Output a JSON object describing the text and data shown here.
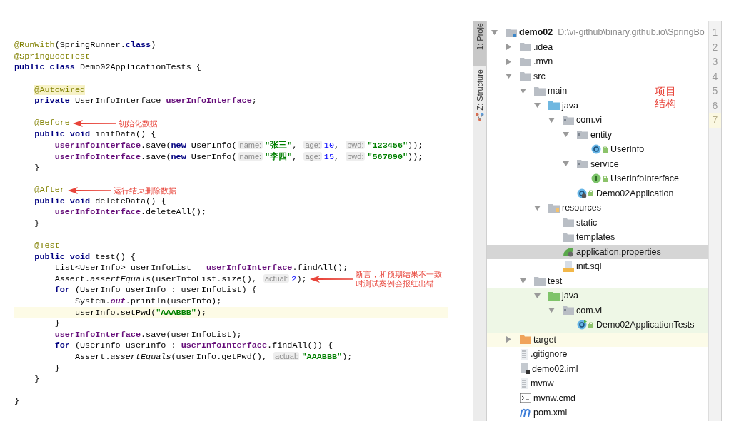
{
  "code": {
    "lines": [
      {
        "tokens": [
          {
            "kind": "ann",
            "t": "@RunWith"
          },
          {
            "kind": "plain",
            "t": "(SpringRunner."
          },
          {
            "kind": "kw",
            "t": "class"
          },
          {
            "kind": "plain",
            "t": ")"
          }
        ]
      },
      {
        "tokens": [
          {
            "kind": "ann",
            "t": "@SpringBootTest"
          }
        ]
      },
      {
        "tokens": [
          {
            "kind": "kw",
            "t": "public class "
          },
          {
            "kind": "plain",
            "t": "Demo02ApplicationTests {"
          }
        ]
      },
      {
        "kind": "blank"
      },
      {
        "tokens": [
          {
            "kind": "annhl",
            "t": "    @Autowired"
          }
        ]
      },
      {
        "tokens": [
          {
            "kind": "kw",
            "t": "    private "
          },
          {
            "kind": "plain",
            "t": "UserInfoInterface "
          },
          {
            "kind": "field",
            "t": "userInfoInterface"
          },
          {
            "kind": "plain",
            "t": ";"
          }
        ]
      },
      {
        "kind": "blank"
      },
      {
        "tokens": [
          {
            "kind": "ann",
            "t": "    @Before"
          }
        ],
        "note": {
          "text": "初始化数据"
        }
      },
      {
        "tokens": [
          {
            "kind": "kw",
            "t": "    public void "
          },
          {
            "kind": "plain",
            "t": "initData() {"
          }
        ]
      },
      {
        "tokens": [
          {
            "kind": "field",
            "t": "        userInfoInterface"
          },
          {
            "kind": "plain",
            "t": ".save("
          },
          {
            "kind": "kw",
            "t": "new "
          },
          {
            "kind": "plain",
            "t": "UserInfo("
          },
          {
            "kind": "hint",
            "t": "name:"
          },
          {
            "kind": "str",
            "t": "\"张三\""
          },
          {
            "kind": "plain",
            "t": ", "
          },
          {
            "kind": "hint",
            "t": "age:"
          },
          {
            "kind": "num",
            "t": "10"
          },
          {
            "kind": "plain",
            "t": ", "
          },
          {
            "kind": "hint",
            "t": "pwd:"
          },
          {
            "kind": "str",
            "t": "\"123456\""
          },
          {
            "kind": "plain",
            "t": "));"
          }
        ]
      },
      {
        "tokens": [
          {
            "kind": "field",
            "t": "        userInfoInterface"
          },
          {
            "kind": "plain",
            "t": ".save("
          },
          {
            "kind": "kw",
            "t": "new "
          },
          {
            "kind": "plain",
            "t": "UserInfo("
          },
          {
            "kind": "hint",
            "t": "name:"
          },
          {
            "kind": "str",
            "t": "\"李四\""
          },
          {
            "kind": "plain",
            "t": ", "
          },
          {
            "kind": "hint",
            "t": "age:"
          },
          {
            "kind": "num",
            "t": "15"
          },
          {
            "kind": "plain",
            "t": ", "
          },
          {
            "kind": "hint",
            "t": "pwd:"
          },
          {
            "kind": "str",
            "t": "\"567890\""
          },
          {
            "kind": "plain",
            "t": "));"
          }
        ]
      },
      {
        "tokens": [
          {
            "kind": "plain",
            "t": "    }"
          }
        ]
      },
      {
        "kind": "blank"
      },
      {
        "tokens": [
          {
            "kind": "ann",
            "t": "    @After"
          }
        ],
        "note": {
          "text": "运行结束删除数据"
        }
      },
      {
        "tokens": [
          {
            "kind": "kw",
            "t": "    public void "
          },
          {
            "kind": "plain",
            "t": "deleteData() {"
          }
        ]
      },
      {
        "tokens": [
          {
            "kind": "field",
            "t": "        userInfoInterface"
          },
          {
            "kind": "plain",
            "t": ".deleteAll();"
          }
        ]
      },
      {
        "tokens": [
          {
            "kind": "plain",
            "t": "    }"
          }
        ]
      },
      {
        "kind": "blank"
      },
      {
        "tokens": [
          {
            "kind": "ann",
            "t": "    @Test"
          }
        ]
      },
      {
        "tokens": [
          {
            "kind": "kw",
            "t": "    public void "
          },
          {
            "kind": "plain",
            "t": "test() {"
          }
        ]
      },
      {
        "tokens": [
          {
            "kind": "plain",
            "t": "        List<UserInfo> userInfoList = "
          },
          {
            "kind": "field",
            "t": "userInfoInterface"
          },
          {
            "kind": "plain",
            "t": ".findAll();"
          }
        ]
      },
      {
        "tokens": [
          {
            "kind": "plain",
            "t": "        Assert."
          },
          {
            "kind": "ital",
            "t": "assertEquals"
          },
          {
            "kind": "plain",
            "t": "(userInfoList.size(), "
          },
          {
            "kind": "hint",
            "t": "actual:"
          },
          {
            "kind": "num",
            "t": "2"
          },
          {
            "kind": "plain",
            "t": ");"
          }
        ],
        "note": {
          "text": "断言，和预期结果不一致时测试案例会报红出错"
        }
      },
      {
        "tokens": [
          {
            "kind": "kw",
            "t": "        for "
          },
          {
            "kind": "plain",
            "t": "(UserInfo userInfo : userInfoList) {"
          }
        ]
      },
      {
        "tokens": [
          {
            "kind": "plain",
            "t": "            System."
          },
          {
            "kind": "static",
            "t": "out"
          },
          {
            "kind": "plain",
            "t": ".println(userInfo);"
          }
        ]
      },
      {
        "tokens": [
          {
            "kind": "plain",
            "t": "            userInfo.setPwd("
          },
          {
            "kind": "str",
            "t": "\"AAABBB\""
          },
          {
            "kind": "plain",
            "t": ");"
          }
        ],
        "current": true
      },
      {
        "tokens": [
          {
            "kind": "plain",
            "t": "        }"
          }
        ]
      },
      {
        "tokens": [
          {
            "kind": "field",
            "t": "        userInfoInterface"
          },
          {
            "kind": "plain",
            "t": ".save(userInfoList);"
          }
        ]
      },
      {
        "tokens": [
          {
            "kind": "kw",
            "t": "        for "
          },
          {
            "kind": "plain",
            "t": "(UserInfo userInfo : "
          },
          {
            "kind": "field",
            "t": "userInfoInterface"
          },
          {
            "kind": "plain",
            "t": ".findAll()) {"
          }
        ]
      },
      {
        "tokens": [
          {
            "kind": "plain",
            "t": "            Assert."
          },
          {
            "kind": "ital",
            "t": "assertEquals"
          },
          {
            "kind": "plain",
            "t": "(userInfo.getPwd(), "
          },
          {
            "kind": "hint",
            "t": "actual:"
          },
          {
            "kind": "str",
            "t": "\"AAABBB\""
          },
          {
            "kind": "plain",
            "t": ");"
          }
        ]
      },
      {
        "tokens": [
          {
            "kind": "plain",
            "t": "        }"
          }
        ]
      },
      {
        "tokens": [
          {
            "kind": "plain",
            "t": "    }"
          }
        ]
      },
      {
        "kind": "blank"
      },
      {
        "tokens": [
          {
            "kind": "plain",
            "t": "}"
          }
        ]
      }
    ]
  },
  "side_tabs": [
    {
      "label": "1: Proje",
      "selected": true
    },
    {
      "label": "Z: Structure",
      "selected": false
    }
  ],
  "project_tree": {
    "note": "项目结构",
    "items": [
      {
        "label": "demo02",
        "path": "D:\\vi-github\\binary.github.io\\SpringBo",
        "kind": "module",
        "expanded": true,
        "selected": false,
        "children": [
          {
            "label": ".idea",
            "kind": "folder",
            "expanded": false,
            "selected": false
          },
          {
            "label": ".mvn",
            "kind": "folder",
            "expanded": false,
            "selected": false
          },
          {
            "label": "src",
            "kind": "folder",
            "expanded": true,
            "selected": false,
            "children": [
              {
                "label": "main",
                "kind": "folder",
                "expanded": true,
                "selected": false,
                "children": [
                  {
                    "label": "java",
                    "kind": "source-folder",
                    "expanded": true,
                    "selected": false,
                    "children": [
                      {
                        "label": "com.vi",
                        "kind": "package",
                        "expanded": true,
                        "selected": false,
                        "children": [
                          {
                            "label": "entity",
                            "kind": "package",
                            "expanded": true,
                            "selected": false,
                            "children": [
                              {
                                "label": "UserInfo",
                                "kind": "class",
                                "selected": false
                              }
                            ]
                          },
                          {
                            "label": "service",
                            "kind": "package",
                            "expanded": true,
                            "selected": false,
                            "children": [
                              {
                                "label": "UserInfoInterface",
                                "kind": "interface",
                                "selected": false
                              }
                            ]
                          },
                          {
                            "label": "Demo02Application",
                            "kind": "spring-app",
                            "selected": false
                          }
                        ]
                      }
                    ]
                  },
                  {
                    "label": "resources",
                    "kind": "resources",
                    "expanded": true,
                    "selected": false,
                    "children": [
                      {
                        "label": "static",
                        "kind": "plain-folder",
                        "selected": false
                      },
                      {
                        "label": "templates",
                        "kind": "plain-folder",
                        "selected": false
                      },
                      {
                        "label": "application.properties",
                        "kind": "properties",
                        "selected": true
                      },
                      {
                        "label": "init.sql",
                        "kind": "sql",
                        "selected": false
                      }
                    ]
                  }
                ]
              },
              {
                "label": "test",
                "kind": "folder",
                "expanded": true,
                "selected": false,
                "children": [
                  {
                    "label": "java",
                    "kind": "test-folder",
                    "expanded": true,
                    "selected": false,
                    "color": "#eef7e6",
                    "children": [
                      {
                        "label": "com.vi",
                        "kind": "package",
                        "expanded": true,
                        "selected": false,
                        "color": "#eef7e6",
                        "children": [
                          {
                            "label": "Demo02ApplicationTests",
                            "kind": "test-class",
                            "selected": false,
                            "color": "#eef7e6"
                          }
                        ]
                      }
                    ]
                  }
                ]
              }
            ]
          },
          {
            "label": "target",
            "kind": "excluded-folder",
            "expanded": false,
            "selected": false,
            "color": "#fcfbe8"
          },
          {
            "label": ".gitignore",
            "kind": "text-file",
            "selected": false
          },
          {
            "label": "demo02.iml",
            "kind": "iml",
            "selected": false
          },
          {
            "label": "mvnw",
            "kind": "text-file",
            "selected": false
          },
          {
            "label": "mvnw.cmd",
            "kind": "cmd",
            "selected": false
          },
          {
            "label": "pom.xml",
            "kind": "maven",
            "selected": false
          }
        ]
      }
    ]
  },
  "editor_gutter": [
    {
      "number": "1",
      "current": false
    },
    {
      "number": "2",
      "current": false
    },
    {
      "number": "3",
      "current": false
    },
    {
      "number": "4",
      "current": false
    },
    {
      "number": "5",
      "current": false
    },
    {
      "number": "6",
      "current": false
    },
    {
      "number": "7",
      "current": true
    }
  ]
}
